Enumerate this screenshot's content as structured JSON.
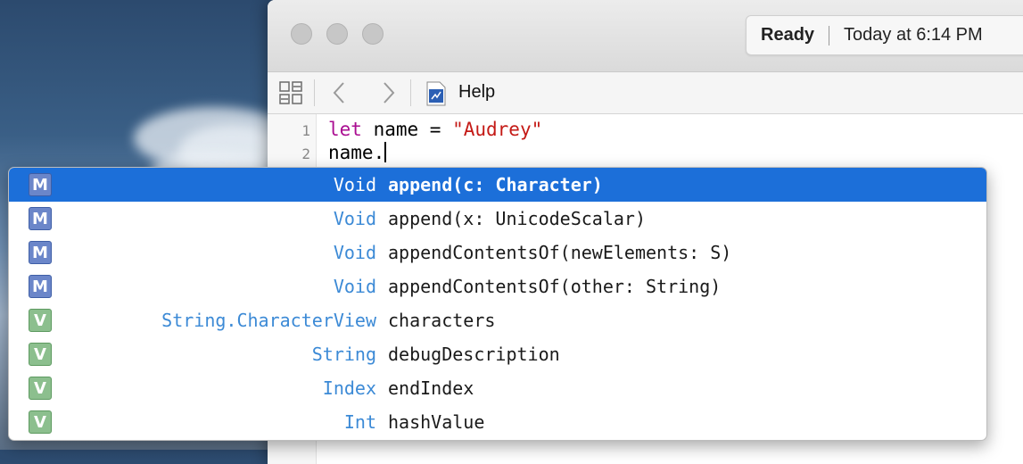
{
  "status": {
    "state": "Ready",
    "timestamp": "Today at 6:14 PM"
  },
  "navbar": {
    "help_label": "Help"
  },
  "editor": {
    "lines": [
      {
        "number": "1",
        "keyword": "let",
        "text": " name = ",
        "string": "\"Audrey\""
      },
      {
        "number": "2",
        "text": "name."
      }
    ]
  },
  "completions": [
    {
      "kind": "M",
      "return_type": "Void",
      "name": "append(c: Character)",
      "selected": true
    },
    {
      "kind": "M",
      "return_type": "Void",
      "name": "append(x: UnicodeScalar)"
    },
    {
      "kind": "M",
      "return_type": "Void",
      "name": "appendContentsOf(newElements: S)"
    },
    {
      "kind": "M",
      "return_type": "Void",
      "name": "appendContentsOf(other: String)"
    },
    {
      "kind": "V",
      "return_type": "String.CharacterView",
      "name": "characters"
    },
    {
      "kind": "V",
      "return_type": "String",
      "name": "debugDescription"
    },
    {
      "kind": "V",
      "return_type": "Index",
      "name": "endIndex"
    },
    {
      "kind": "V",
      "return_type": "Int",
      "name": "hashValue"
    }
  ],
  "colors": {
    "selection": "#1c6fd9",
    "method_badge": "#6b86c9",
    "variable_badge": "#8cbf8e",
    "type_text": "#3c8ad6",
    "keyword": "#aa0d91",
    "string_literal": "#c41a16"
  },
  "icons": [
    "related-items-icon",
    "back-chevron-icon",
    "forward-chevron-icon",
    "playground-file-icon"
  ]
}
